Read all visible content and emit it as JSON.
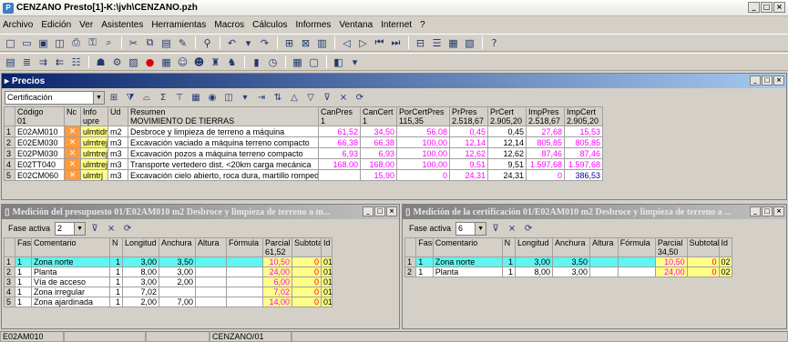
{
  "app": {
    "title": "CENZANO Presto[1]-K:\\jvh\\CENZANO.pzh"
  },
  "menu": [
    "Archivo",
    "Edición",
    "Ver",
    "Asistentes",
    "Herramientas",
    "Macros",
    "Cálculos",
    "Informes",
    "Ventana",
    "Internet",
    "?"
  ],
  "precios": {
    "title": "Precios",
    "filter_value": "Certificación",
    "headers": {
      "codigo": "Código",
      "codigo_sub": "01",
      "nc": "Nc",
      "info": "Info",
      "info_sub": "upre",
      "ud": "Ud",
      "resumen": "Resumen",
      "resumen_sub": "MOVIMIENTO DE TIERRAS",
      "canpres": "CanPres",
      "canpres_sub": "1",
      "cancert": "CanCert",
      "cancert_sub": "1",
      "porcert": "PorCertPres",
      "porcert_sub": "115,35",
      "prpres": "PrPres",
      "prpres_sub": "2.518,67",
      "prcert": "PrCert",
      "prcert_sub": "2.905,20",
      "imppres": "ImpPres",
      "imppres_sub": "2.518,67",
      "impcert": "ImpCert",
      "impcert_sub": "2.905,20"
    },
    "rows": [
      {
        "n": "1",
        "codigo": "E02AM010",
        "info": "ulmtidrej",
        "ud": "m2",
        "resumen": "Desbroce y limpieza de terreno a máquina",
        "canpres": "61,52",
        "cancert": "34,50",
        "porcert": "56,08",
        "prpres": "0,45",
        "prcert": "0,45",
        "imppres": "27,68",
        "impcert": "15,53"
      },
      {
        "n": "2",
        "codigo": "E02EM030",
        "info": "ulmtrej",
        "ud": "m3",
        "resumen": "Excavación vaciado a máquina terreno compacto",
        "canpres": "66,38",
        "cancert": "66,38",
        "porcert": "100,00",
        "prpres": "12,14",
        "prcert": "12,14",
        "imppres": "805,85",
        "impcert": "805,85"
      },
      {
        "n": "3",
        "codigo": "E02PM030",
        "info": "ulmtrej",
        "ud": "m3",
        "resumen": "Excavación pozos a máquina terreno compacto",
        "canpres": "6,93",
        "cancert": "6,93",
        "porcert": "100,00",
        "prpres": "12,62",
        "prcert": "12,62",
        "imppres": "87,46",
        "impcert": "87,46"
      },
      {
        "n": "4",
        "codigo": "E02TT040",
        "info": "ulmtrej",
        "ud": "m3",
        "resumen": "Transporte vertedero dist. <20km carga mecánica",
        "canpres": "168,00",
        "cancert": "168,00",
        "porcert": "100,00",
        "prpres": "9,51",
        "prcert": "9,51",
        "imppres": "1.597,68",
        "impcert": "1.597,68"
      },
      {
        "n": "5",
        "codigo": "E02CM060",
        "info": "ulmtrj",
        "ud": "m3",
        "resumen": "Excavación cielo abierto, roca dura, martillo rompedor",
        "canpres": "",
        "cancert": "15,90",
        "porcert": "0",
        "prpres": "24,31",
        "prcert": "24,31",
        "imppres": "0",
        "impcert": "386,53"
      }
    ]
  },
  "medicion_pres": {
    "title": "Medición del presupuesto 01/E02AM010 m2 Desbroce y limpieza de terreno a m...",
    "fase_label": "Fase activa",
    "fase_value": "2",
    "headers": {
      "fase": "Fase",
      "comentario": "Comentario",
      "n": "N",
      "longitud": "Longitud",
      "anchura": "Anchura",
      "altura": "Altura",
      "formula": "Fórmula",
      "parcial": "Parcial",
      "parcial_sub": "61,52",
      "subtotal": "Subtotal",
      "id": "Id"
    },
    "rows": [
      {
        "rn": "1",
        "fase": "1",
        "comentario": "Zona norte",
        "n": "1",
        "longitud": "3,00",
        "anchura": "3,50",
        "altura": "",
        "formula": "",
        "parcial": "10,50",
        "subtotal": "0",
        "id": "01"
      },
      {
        "rn": "2",
        "fase": "1",
        "comentario": "Planta",
        "n": "1",
        "longitud": "8,00",
        "anchura": "3,00",
        "altura": "",
        "formula": "",
        "parcial": "24,00",
        "subtotal": "0",
        "id": "01"
      },
      {
        "rn": "3",
        "fase": "1",
        "comentario": "Vía de acceso",
        "n": "1",
        "longitud": "3,00",
        "anchura": "2,00",
        "altura": "",
        "formula": "",
        "parcial": "6,00",
        "subtotal": "0",
        "id": "01"
      },
      {
        "rn": "4",
        "fase": "1",
        "comentario": "Zona irregular",
        "n": "1",
        "longitud": "7,02",
        "anchura": "",
        "altura": "",
        "formula": "",
        "parcial": "7,02",
        "subtotal": "0",
        "id": "01"
      },
      {
        "rn": "5",
        "fase": "1",
        "comentario": "Zona ajardinada",
        "n": "1",
        "longitud": "2,00",
        "anchura": "7,00",
        "altura": "",
        "formula": "",
        "parcial": "14,00",
        "subtotal": "0",
        "id": "01"
      }
    ]
  },
  "medicion_cert": {
    "title": "Medición de la certificación 01/E02AM010 m2 Desbroce y limpieza de terreno a ...",
    "fase_label": "Fase activa",
    "fase_value": "6",
    "headers": {
      "fase": "Fase",
      "comentario": "Comentario",
      "n": "N",
      "longitud": "Longitud",
      "anchura": "Anchura",
      "altura": "Altura",
      "formula": "Fórmula",
      "parcial": "Parcial",
      "parcial_sub": "34,50",
      "subtotal": "Subtotal",
      "id": "Id"
    },
    "rows": [
      {
        "rn": "1",
        "fase": "1",
        "comentario": "Zona norte",
        "n": "1",
        "longitud": "3,00",
        "anchura": "3,50",
        "altura": "",
        "formula": "",
        "parcial": "10,50",
        "subtotal": "0",
        "id": "02"
      },
      {
        "rn": "2",
        "fase": "1",
        "comentario": "Planta",
        "n": "1",
        "longitud": "8,00",
        "anchura": "3,00",
        "altura": "",
        "formula": "",
        "parcial": "24,00",
        "subtotal": "0",
        "id": "02"
      }
    ]
  },
  "status": {
    "left": "E02AM010",
    "middle": "CENZANO/01"
  }
}
